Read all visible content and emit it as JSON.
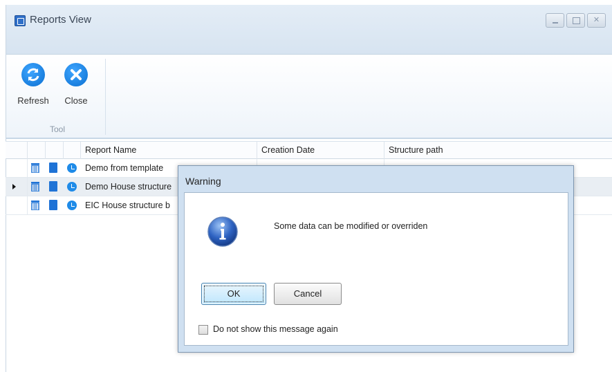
{
  "window": {
    "title": "Reports View",
    "controls": {
      "minimize": "minimize",
      "maximize": "maximize",
      "close": "✕"
    }
  },
  "ribbon": {
    "group_label": "Tool",
    "buttons": [
      {
        "label": "Refresh",
        "icon": "refresh-icon",
        "color": "#0a6fd1"
      },
      {
        "label": "Close",
        "icon": "close-icon",
        "color": "#0a6fd1"
      }
    ]
  },
  "grid": {
    "columns": [
      "Report Name",
      "Creation Date",
      "Structure path"
    ],
    "rows": [
      {
        "name": "Demo from template",
        "selected": false
      },
      {
        "name": "Demo House structure",
        "selected": true
      },
      {
        "name": "EIC House structure b",
        "selected": false
      }
    ]
  },
  "dialog": {
    "title": "Warning",
    "message": "Some data can be modified or overriden",
    "ok_label": "OK",
    "cancel_label": "Cancel",
    "checkbox_label": "Do not show this message again",
    "checkbox_checked": false,
    "icon": "info-icon"
  }
}
